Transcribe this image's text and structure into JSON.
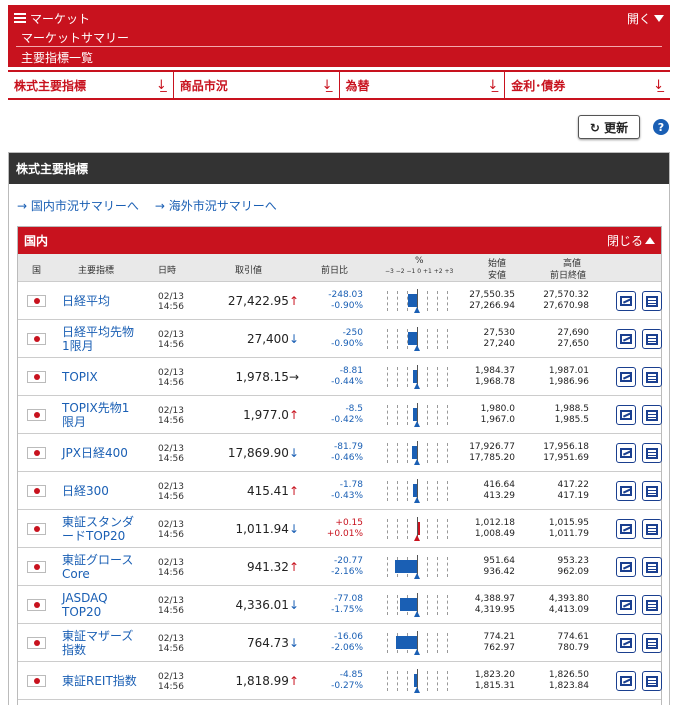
{
  "header": {
    "menu_label": "マーケット",
    "open_label": "開く",
    "crumb1": "マーケットサマリー",
    "crumb2": "主要指標一覧"
  },
  "tabs": [
    {
      "label": "株式主要指標"
    },
    {
      "label": "商品市況"
    },
    {
      "label": "為替"
    },
    {
      "label": "金利･債券"
    }
  ],
  "toolbar": {
    "refresh_label": "↻ 更新",
    "help_label": "?"
  },
  "section": {
    "title": "株式主要指標",
    "link_domestic": "→ 国内市況サマリーへ",
    "link_overseas": "→ 海外市況サマリーへ"
  },
  "panel": {
    "title": "国内",
    "close_label": "閉じる",
    "columns": {
      "country": "国",
      "name": "主要指標",
      "time": "日時",
      "price": "取引値",
      "change": "前日比",
      "percent": "%",
      "scale": "−3 −2 −1 0 +1 +2 +3",
      "open_low1": "始値",
      "open_low2": "安値",
      "high_prev1": "高値",
      "high_prev2": "前日終値"
    }
  },
  "rows": [
    {
      "name": "日経平均",
      "date": "02/13",
      "time": "14:56",
      "price": "27,422.95",
      "arrow": "↑",
      "dir": "up",
      "chg": "-248.03",
      "pct": "-0.90%",
      "pct_val": -0.9,
      "open": "27,550.35",
      "low": "27,266.94",
      "high": "27,570.32",
      "prev": "27,670.98"
    },
    {
      "name": "日経平均先物1限月",
      "date": "02/13",
      "time": "14:56",
      "price": "27,400",
      "arrow": "↓",
      "dir": "dn",
      "chg": "-250",
      "pct": "-0.90%",
      "pct_val": -0.9,
      "open": "27,530",
      "low": "27,240",
      "high": "27,690",
      "prev": "27,650"
    },
    {
      "name": "TOPIX",
      "date": "02/13",
      "time": "14:56",
      "price": "1,978.15",
      "arrow": "→",
      "dir": "fl",
      "chg": "-8.81",
      "pct": "-0.44%",
      "pct_val": -0.44,
      "open": "1,984.37",
      "low": "1,968.78",
      "high": "1,987.01",
      "prev": "1,986.96"
    },
    {
      "name": "TOPIX先物1限月",
      "date": "02/13",
      "time": "14:56",
      "price": "1,977.0",
      "arrow": "↑",
      "dir": "up",
      "chg": "-8.5",
      "pct": "-0.42%",
      "pct_val": -0.42,
      "open": "1,980.0",
      "low": "1,967.0",
      "high": "1,988.5",
      "prev": "1,985.5"
    },
    {
      "name": "JPX日経400",
      "date": "02/13",
      "time": "14:56",
      "price": "17,869.90",
      "arrow": "↓",
      "dir": "dn",
      "chg": "-81.79",
      "pct": "-0.46%",
      "pct_val": -0.46,
      "open": "17,926.77",
      "low": "17,785.20",
      "high": "17,956.18",
      "prev": "17,951.69"
    },
    {
      "name": "日経300",
      "date": "02/13",
      "time": "14:56",
      "price": "415.41",
      "arrow": "↑",
      "dir": "up",
      "chg": "-1.78",
      "pct": "-0.43%",
      "pct_val": -0.43,
      "open": "416.64",
      "low": "413.29",
      "high": "417.22",
      "prev": "417.19"
    },
    {
      "name": "東証スタンダードTOP20",
      "date": "02/13",
      "time": "14:56",
      "price": "1,011.94",
      "arrow": "↓",
      "dir": "dn",
      "chg": "+0.15",
      "pct": "+0.01%",
      "pct_val": 0.01,
      "open": "1,012.18",
      "low": "1,008.49",
      "high": "1,015.95",
      "prev": "1,011.79"
    },
    {
      "name": "東証グロースCore",
      "date": "02/13",
      "time": "14:56",
      "price": "941.32",
      "arrow": "↑",
      "dir": "up",
      "chg": "-20.77",
      "pct": "-2.16%",
      "pct_val": -2.16,
      "open": "951.64",
      "low": "936.42",
      "high": "953.23",
      "prev": "962.09"
    },
    {
      "name": "JASDAQ TOP20",
      "date": "02/13",
      "time": "14:56",
      "price": "4,336.01",
      "arrow": "↓",
      "dir": "dn",
      "chg": "-77.08",
      "pct": "-1.75%",
      "pct_val": -1.75,
      "open": "4,388.97",
      "low": "4,319.95",
      "high": "4,393.80",
      "prev": "4,413.09"
    },
    {
      "name": "東証マザーズ指数",
      "date": "02/13",
      "time": "14:56",
      "price": "764.73",
      "arrow": "↓",
      "dir": "dn",
      "chg": "-16.06",
      "pct": "-2.06%",
      "pct_val": -2.06,
      "open": "774.21",
      "low": "762.97",
      "high": "774.61",
      "prev": "780.79"
    },
    {
      "name": "東証REIT指数",
      "date": "02/13",
      "time": "14:56",
      "price": "1,818.99",
      "arrow": "↑",
      "dir": "up",
      "chg": "-4.85",
      "pct": "-0.27%",
      "pct_val": -0.27,
      "open": "1,823.20",
      "low": "1,815.31",
      "high": "1,826.50",
      "prev": "1,823.84"
    }
  ],
  "colors": {
    "brand_red": "#c8121e",
    "link_blue": "#1a5fb4",
    "header_dark": "#333333"
  }
}
